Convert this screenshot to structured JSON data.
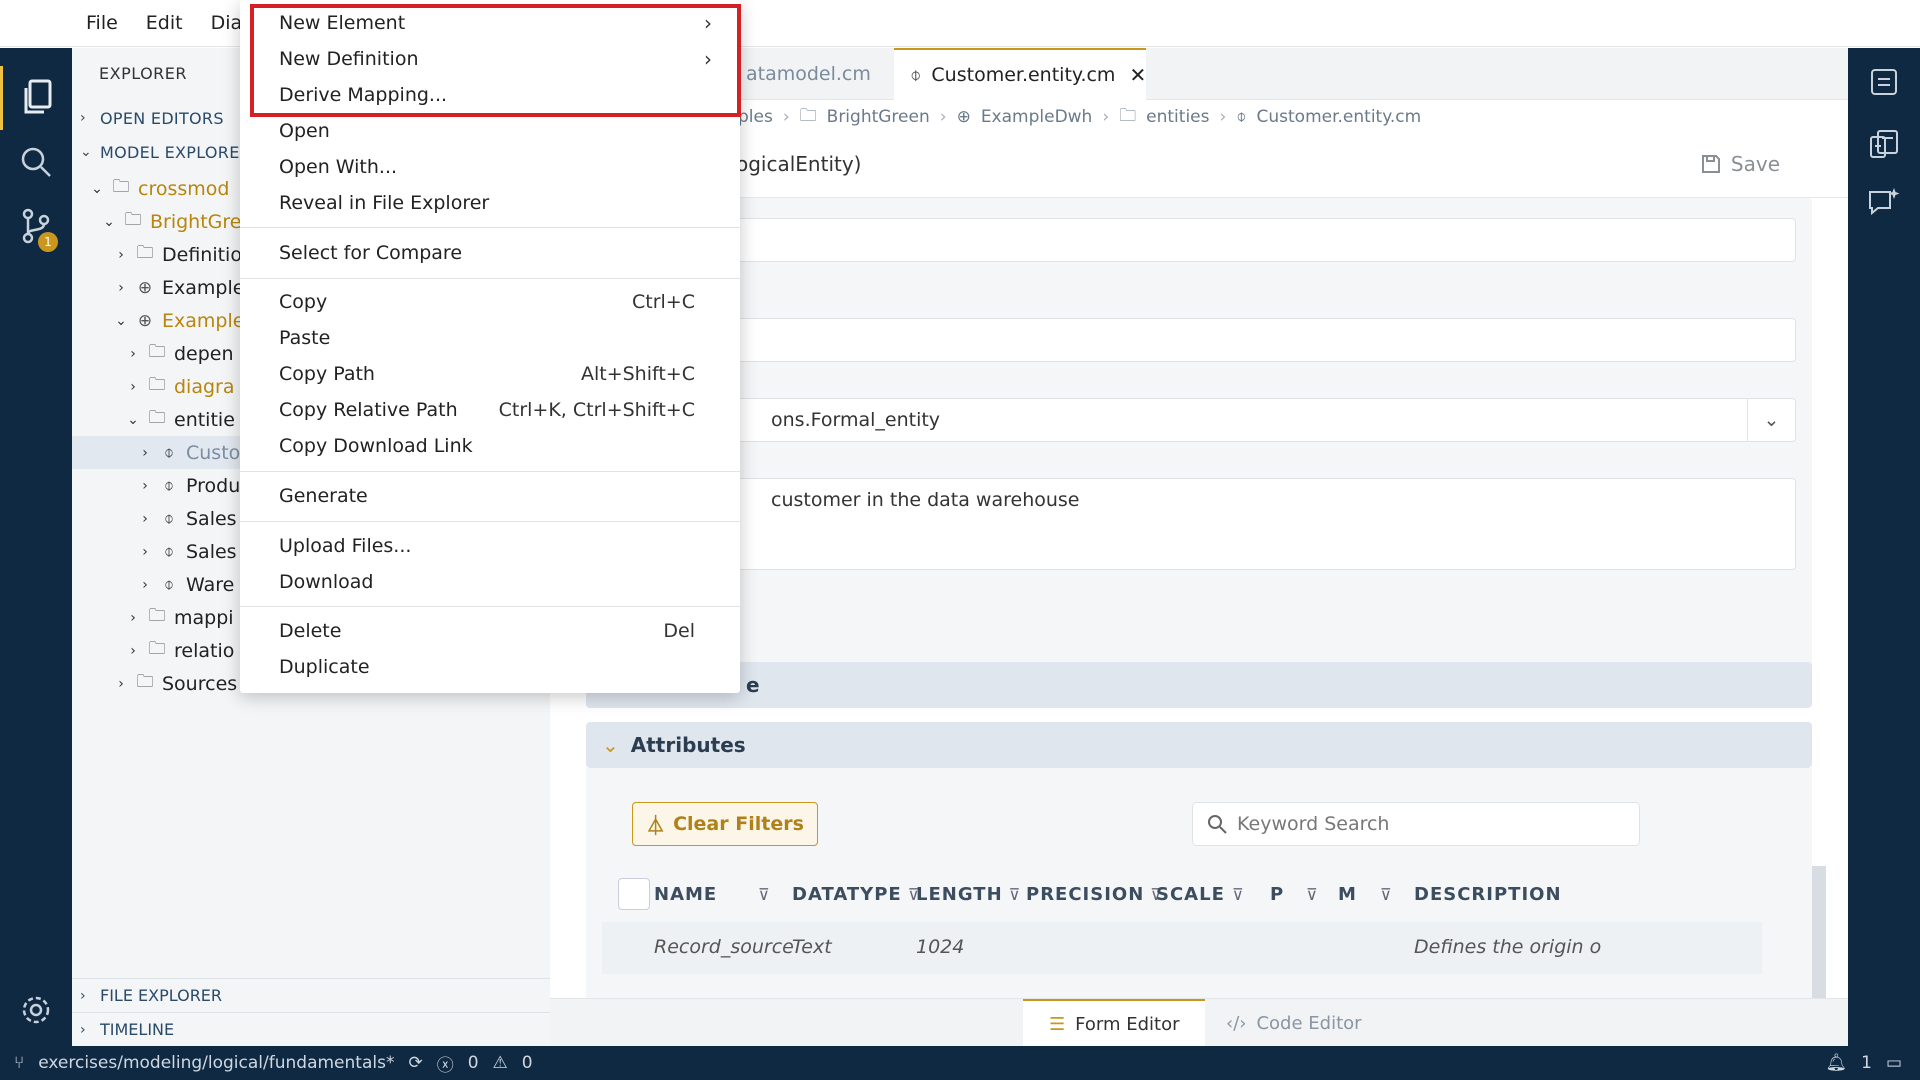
{
  "menubar": {
    "file": "File",
    "edit": "Edit",
    "diagram": "Diag"
  },
  "explorer": {
    "header": "EXPLORER",
    "open_editors": "OPEN EDITORS",
    "model_explorer": "MODEL EXPLORER",
    "file_explorer": "FILE EXPLORER",
    "timeline": "TIMELINE",
    "tree": [
      {
        "label": "crossmod",
        "icon": "folder",
        "mod": true
      },
      {
        "label": "BrightGre",
        "icon": "folder",
        "mod": true
      },
      {
        "label": "Definitio",
        "icon": "folder"
      },
      {
        "label": "Example",
        "icon": "globe"
      },
      {
        "label": "Example",
        "icon": "globe",
        "mod": true
      },
      {
        "label": "depen",
        "icon": "folder"
      },
      {
        "label": "diagra",
        "icon": "folder",
        "mod": true
      },
      {
        "label": "entitie",
        "icon": "folder"
      },
      {
        "label": "Custo",
        "icon": "entity",
        "selected": true
      },
      {
        "label": "Produ",
        "icon": "entity"
      },
      {
        "label": "Sales",
        "icon": "entity"
      },
      {
        "label": "Sales",
        "icon": "entity"
      },
      {
        "label": "Ware",
        "icon": "entity"
      },
      {
        "label": "mappi",
        "icon": "folder"
      },
      {
        "label": "relatio",
        "icon": "folder"
      },
      {
        "label": "Sources",
        "icon": "folder"
      }
    ]
  },
  "activity": {
    "scm_badge": "1"
  },
  "tabs": {
    "inactive": "atamodel.cm",
    "active": "Customer.entity.cm"
  },
  "breadcrumb": [
    "ples",
    "BrightGreen",
    "ExampleDwh",
    "entities",
    "Customer.entity.cm"
  ],
  "editor": {
    "title": "ogicalEntity)",
    "save": "Save",
    "inherit_value": "ons.Formal_entity",
    "description_value": "customer in the data warehouse",
    "collapsed_panel": "e",
    "attributes_panel": "Attributes",
    "clear_filters": "Clear Filters",
    "search_placeholder": "Keyword Search",
    "columns": [
      "NAME",
      "DATATYPE",
      "LENGTH",
      "PRECISION",
      "SCALE",
      "P",
      "M",
      "DESCRIPTION"
    ],
    "row": {
      "name": "Record_source",
      "datatype": "Text",
      "length": "1024",
      "description": "Defines the origin o"
    },
    "form_editor": "Form Editor",
    "code_editor": "Code Editor"
  },
  "statusbar": {
    "branch": "exercises/modeling/logical/fundamentals*",
    "errors": "0",
    "warnings": "0",
    "notifications": "1"
  },
  "context_menu": {
    "new_element": "New Element",
    "new_definition": "New Definition",
    "derive_mapping": "Derive Mapping...",
    "open": "Open",
    "open_with": "Open With...",
    "reveal": "Reveal in File Explorer",
    "select_compare": "Select for Compare",
    "copy": "Copy",
    "copy_key": "Ctrl+C",
    "paste": "Paste",
    "copy_path": "Copy Path",
    "copy_path_key": "Alt+Shift+C",
    "copy_rel_path": "Copy Relative Path",
    "copy_rel_path_key": "Ctrl+K, Ctrl+Shift+C",
    "copy_download": "Copy Download Link",
    "generate": "Generate",
    "upload": "Upload Files...",
    "download": "Download",
    "delete": "Delete",
    "delete_key": "Del",
    "duplicate": "Duplicate"
  }
}
